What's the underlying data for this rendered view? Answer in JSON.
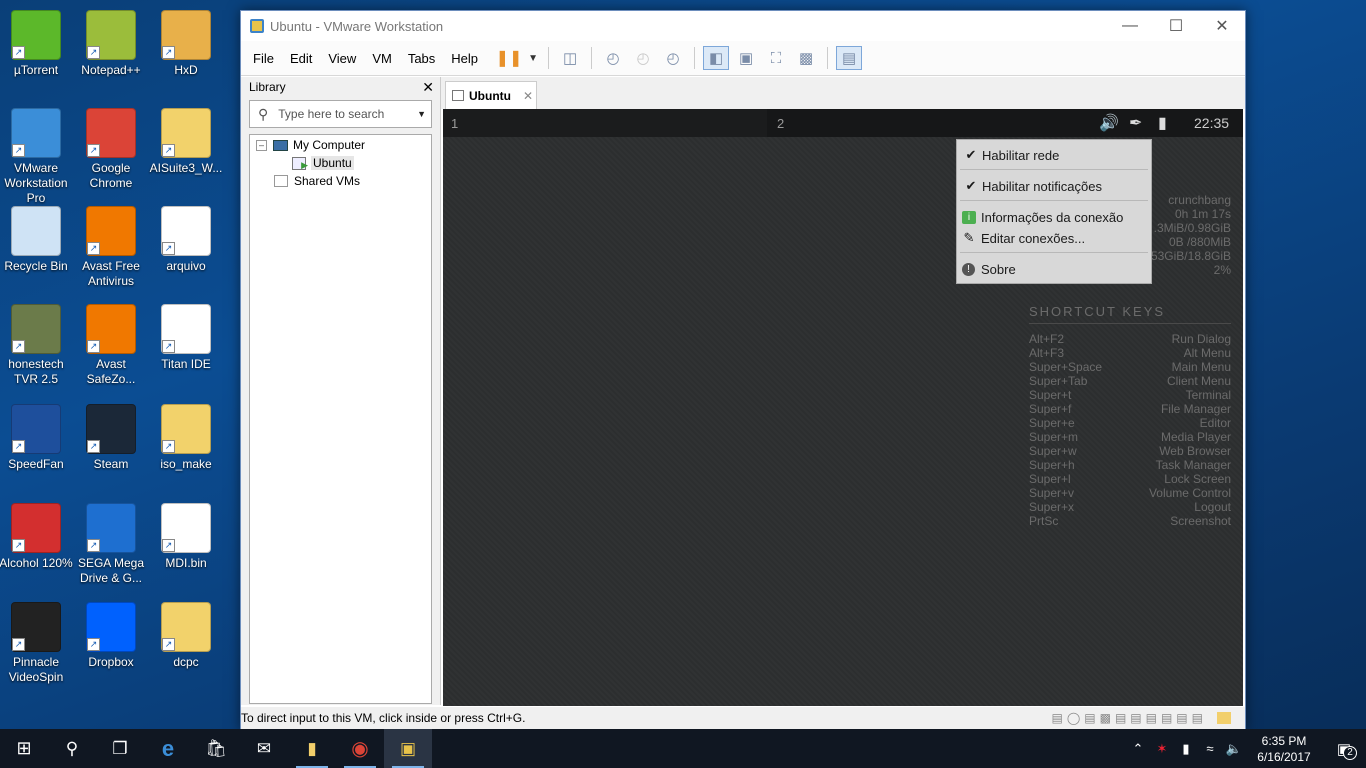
{
  "desktop": {
    "icons": [
      {
        "label": "µTorrent",
        "icon": "utorrent-icon",
        "color": "#5cb82a"
      },
      {
        "label": "Notepad++",
        "icon": "notepadpp-icon",
        "color": "#9bbd3b"
      },
      {
        "label": "HxD",
        "icon": "hxd-icon",
        "color": "#e8b04a"
      },
      {
        "label": "VMware Workstation Pro",
        "icon": "vmware-icon",
        "color": "#3b8ed8"
      },
      {
        "label": "Google Chrome",
        "icon": "chrome-icon",
        "color": "#db4437"
      },
      {
        "label": "AISuite3_W...",
        "icon": "folder-icon",
        "color": "#f2d26b"
      },
      {
        "label": "Recycle Bin",
        "icon": "recycle-bin-icon",
        "color": "#cfe3f5"
      },
      {
        "label": "Avast Free Antivirus",
        "icon": "avast-icon",
        "color": "#f07800"
      },
      {
        "label": "arquivo",
        "icon": "document-icon",
        "color": "#ffffff"
      },
      {
        "label": "honestech TVR 2.5",
        "icon": "honestech-icon",
        "color": "#6b7b4a"
      },
      {
        "label": "Avast SafeZo...",
        "icon": "avast-safezone-icon",
        "color": "#f07800"
      },
      {
        "label": "Titan IDE",
        "icon": "titan-ide-icon",
        "color": "#ffffff"
      },
      {
        "label": "SpeedFan",
        "icon": "speedfan-icon",
        "color": "#1e4f9c"
      },
      {
        "label": "Steam",
        "icon": "steam-icon",
        "color": "#1b2838"
      },
      {
        "label": "iso_make",
        "icon": "folder-icon",
        "color": "#f2d26b"
      },
      {
        "label": "Alcohol 120%",
        "icon": "alcohol-icon",
        "color": "#d32f2f"
      },
      {
        "label": "SEGA Mega Drive & G...",
        "icon": "sega-icon",
        "color": "#1e6fd0"
      },
      {
        "label": "MDI.bin",
        "icon": "file-icon",
        "color": "#ffffff"
      },
      {
        "label": "Pinnacle VideoSpin",
        "icon": "pinnacle-icon",
        "color": "#222222"
      },
      {
        "label": "Dropbox",
        "icon": "dropbox-icon",
        "color": "#0061fe"
      },
      {
        "label": "dcpc",
        "icon": "folder-icon",
        "color": "#f2d26b"
      }
    ]
  },
  "window": {
    "title": "Ubuntu - VMware Workstation",
    "menu": [
      "File",
      "Edit",
      "View",
      "VM",
      "Tabs",
      "Help"
    ],
    "library": {
      "title": "Library",
      "search_placeholder": "Type here to search",
      "tree": {
        "my_computer": "My Computer",
        "vm": "Ubuntu",
        "shared": "Shared VMs"
      }
    },
    "tab": {
      "label": "Ubuntu"
    },
    "status": "To direct input to this VM, click inside or press Ctrl+G."
  },
  "vm": {
    "workspace_1": "1",
    "workspace_2": "2",
    "clock": "22:35",
    "menu": {
      "item1": "Habilitar rede",
      "item2": "Habilitar notificações",
      "item3": "Informações da conexão",
      "item4": "Editar conexões...",
      "item5": "Sobre"
    },
    "sysinfo": [
      "crunchbang",
      "0h 1m 17s",
      ".3MiB/0.98GiB",
      "0B  /880MiB",
      "53GiB/18.8GiB",
      "2%"
    ],
    "shortcuts_title": "SHORTCUT KEYS",
    "shortcuts": [
      {
        "key": "Alt+F2",
        "action": "Run Dialog"
      },
      {
        "key": "Alt+F3",
        "action": "Alt Menu"
      },
      {
        "key": "Super+Space",
        "action": "Main Menu"
      },
      {
        "key": "Super+Tab",
        "action": "Client Menu"
      },
      {
        "key": "Super+t",
        "action": "Terminal"
      },
      {
        "key": "Super+f",
        "action": "File Manager"
      },
      {
        "key": "Super+e",
        "action": "Editor"
      },
      {
        "key": "Super+m",
        "action": "Media Player"
      },
      {
        "key": "Super+w",
        "action": "Web Browser"
      },
      {
        "key": "Super+h",
        "action": "Task Manager"
      },
      {
        "key": "Super+l",
        "action": "Lock Screen"
      },
      {
        "key": "Super+v",
        "action": "Volume Control"
      },
      {
        "key": "Super+x",
        "action": "Logout"
      },
      {
        "key": "PrtSc",
        "action": "Screenshot"
      }
    ]
  },
  "taskbar": {
    "time": "6:35 PM",
    "date": "6/16/2017",
    "notifications": "2"
  }
}
